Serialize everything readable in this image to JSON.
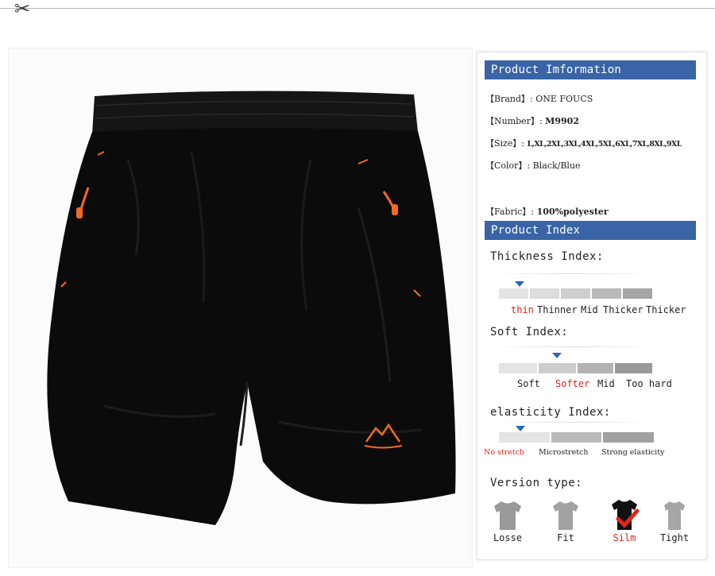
{
  "header": {
    "cut_icon": "scissors-icon"
  },
  "product_info": {
    "heading": "Product Imformation",
    "brand_key": "【Brand】:",
    "brand": "ONE FOUCS",
    "number_key": "【Number】:",
    "number": "M9902",
    "size_key": "【Size】:",
    "size": "L,XL,2XL,3XL,4XL,5XL,6XL,7XL,8XL,9XL",
    "color_key": "【Color】:",
    "color": "Black/Blue",
    "fabric_key": "【Fabric】:",
    "fabric": "100%polyester"
  },
  "product_index": {
    "heading": "Product Index",
    "thickness": {
      "title": "Thickness Index:",
      "labels": [
        "thin",
        "Thinner",
        "Mid",
        "Thicker",
        "Thicker"
      ],
      "selected_index": 0
    },
    "soft": {
      "title": "Soft Index:",
      "labels": [
        "Soft",
        "Softer",
        "Mid",
        "Too hard"
      ],
      "selected_index": 1
    },
    "elasticity": {
      "title": "elasticity Index:",
      "labels": [
        "No stretch",
        "Microstretch",
        "Strong elasticity"
      ],
      "selected_index": 0
    }
  },
  "version": {
    "title": "Version type:",
    "types": [
      "Losse",
      "Fit",
      "Silm",
      "Tight"
    ],
    "selected_index": 2
  },
  "colors": {
    "accent_blue": "#3a64a6",
    "highlight_red": "#e3241a",
    "shorts_black": "#0b0b0b",
    "zipper_orange": "#f26a21"
  }
}
